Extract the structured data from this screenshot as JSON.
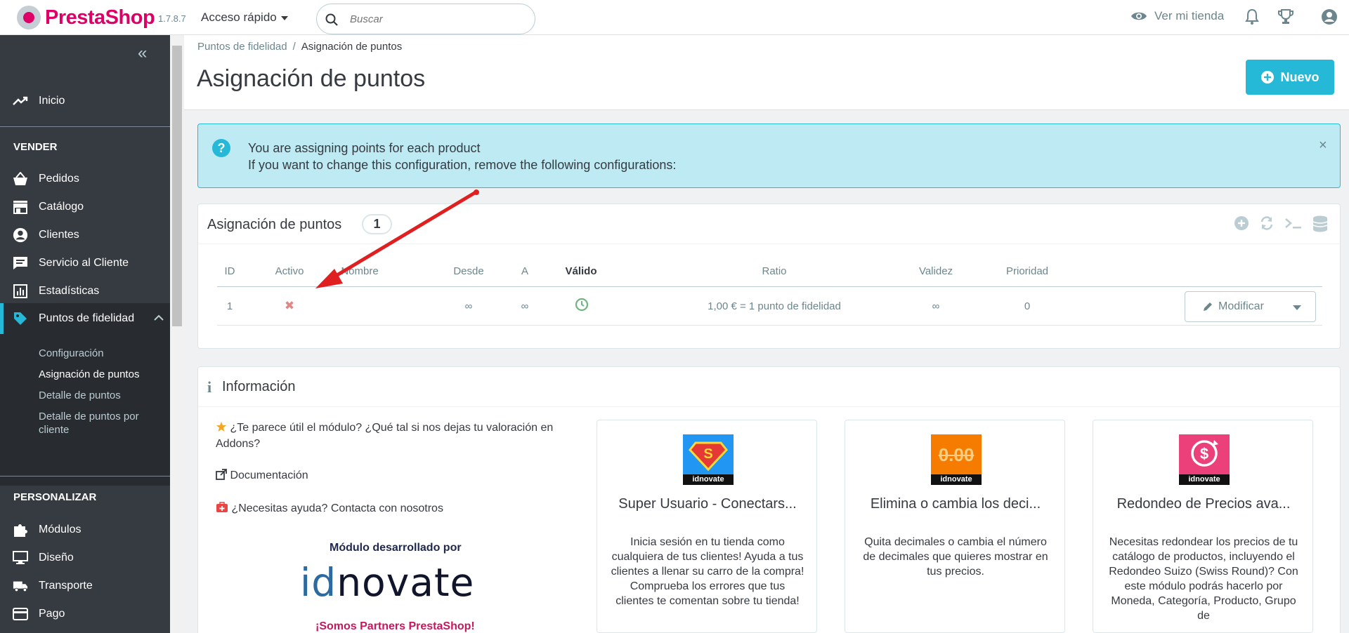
{
  "header": {
    "brand": "PrestaShop",
    "version": "1.7.8.7",
    "quick_access": "Acceso rápido",
    "search_placeholder": "Buscar",
    "view_shop": "Ver mi tienda"
  },
  "sidebar": {
    "home": "Inicio",
    "section_sell": "VENDER",
    "sell_items": [
      "Pedidos",
      "Catálogo",
      "Clientes",
      "Servicio al Cliente",
      "Estadísticas",
      "Puntos de fidelidad"
    ],
    "submenu": [
      "Configuración",
      "Asignación de puntos",
      "Detalle de puntos",
      "Detalle de puntos por cliente"
    ],
    "section_custom": "PERSONALIZAR",
    "custom_items": [
      "Módulos",
      "Diseño",
      "Transporte",
      "Pago"
    ]
  },
  "page": {
    "breadcrumb_parent": "Puntos de fidelidad",
    "breadcrumb_sep": "/",
    "breadcrumb_current": "Asignación de puntos",
    "title": "Asignación de puntos",
    "new_button": "Nuevo"
  },
  "alert": {
    "line1": "You are assigning points for each product",
    "line2": "If you want to change this configuration, remove the following configurations:",
    "close": "×"
  },
  "list": {
    "title": "Asignación de puntos",
    "count": "1",
    "columns": [
      "ID",
      "Activo",
      "Nombre",
      "Desde",
      "A",
      "Válido",
      "Ratio",
      "Validez",
      "Prioridad"
    ],
    "row": {
      "id": "1",
      "active": "✖",
      "name": "",
      "from": "∞",
      "to": "∞",
      "ratio": "1,00 € = 1 punto de fidelidad",
      "validity": "∞",
      "priority": "0"
    },
    "modify_button": "Modificar"
  },
  "info": {
    "title": "Información",
    "rate": "¿Te parece útil el módulo? ¿Qué tal si nos dejas tu valoración en Addons?",
    "docs": "Documentación",
    "help": "¿Necesitas ayuda? Contacta con nosotros",
    "developed_by": "Módulo desarrollado por",
    "logo_id": "id",
    "logo_rest": "novate",
    "partners": "¡Somos Partners PrestaShop!",
    "cards": [
      {
        "title": "Super Usuario - Conectars...",
        "desc": "Inicia sesión en tu tienda como cualquiera de tus clientes! Ayuda a tus clientes a llenar su carro de la compra! Comprueba los errores que tus clientes te comentan sobre tu tienda!",
        "thumb_label": "idnovate",
        "thumb_color": "#2196f3"
      },
      {
        "title": "Elimina o cambia los deci...",
        "desc": "Quita decimales o cambia el número de decimales que quieres mostrar en tus precios.",
        "thumb_label": "idnovate",
        "thumb_text": "0.00",
        "thumb_color": "#f57c00"
      },
      {
        "title": "Redondeo de Precios ava...",
        "desc": "Necesitas redondear los precios de tu catálogo de productos, incluyendo el Redondeo Suizo (Swiss Round)? Con este módulo podrás hacerlo por Moneda, Categoría, Producto, Grupo de",
        "thumb_label": "idnovate",
        "thumb_color": "#ec407a"
      }
    ]
  }
}
